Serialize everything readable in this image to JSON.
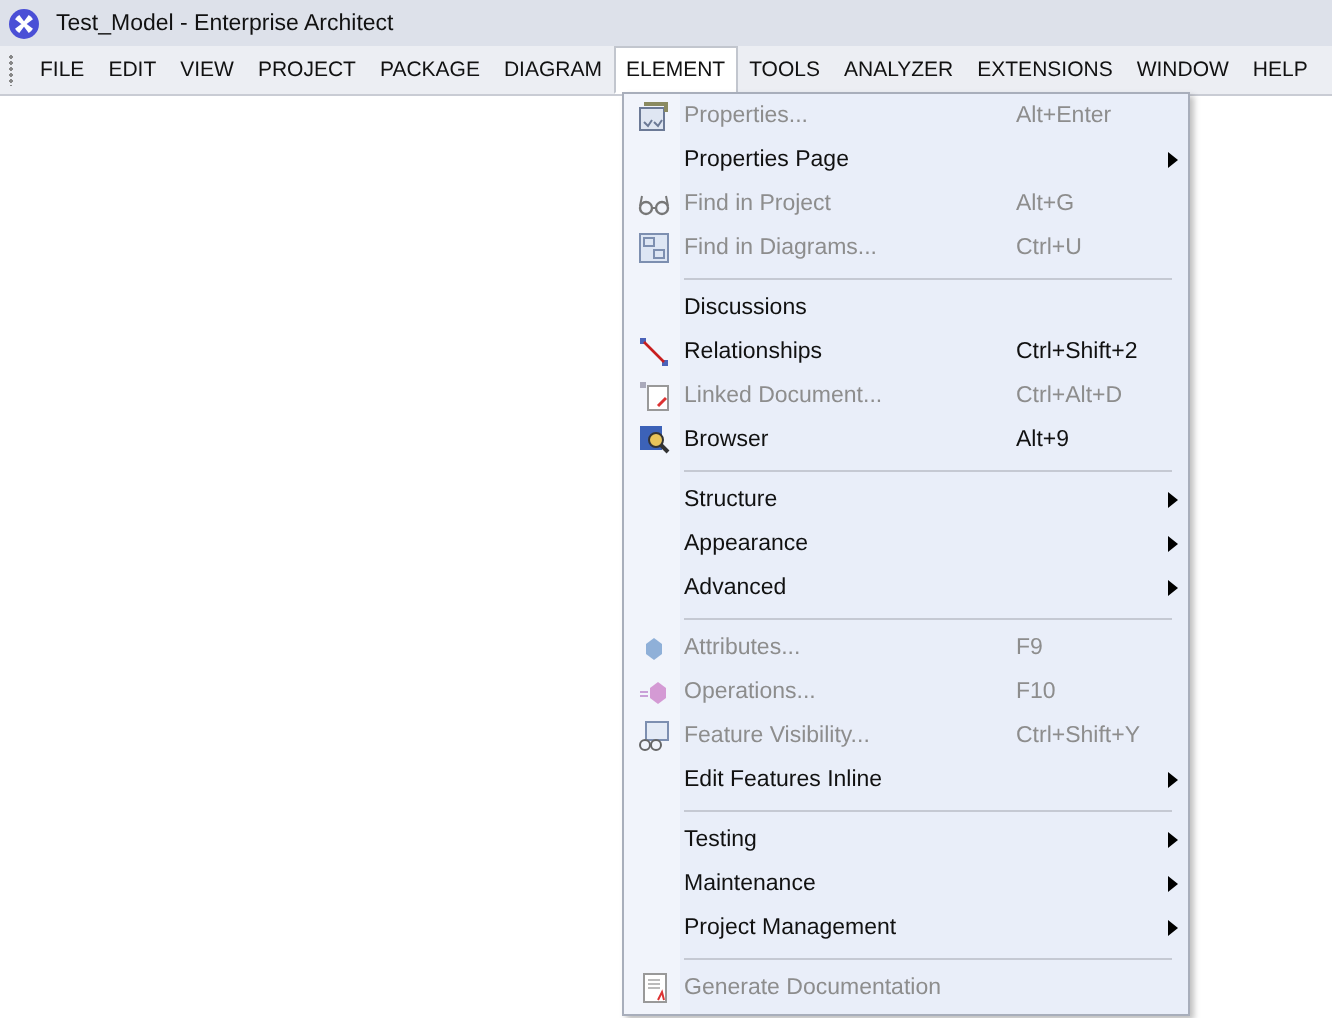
{
  "window": {
    "title": "Test_Model - Enterprise Architect"
  },
  "menubar": [
    {
      "label": "FILE",
      "selected": false
    },
    {
      "label": "EDIT",
      "selected": false
    },
    {
      "label": "VIEW",
      "selected": false
    },
    {
      "label": "PROJECT",
      "selected": false
    },
    {
      "label": "PACKAGE",
      "selected": false
    },
    {
      "label": "DIAGRAM",
      "selected": false
    },
    {
      "label": "ELEMENT",
      "selected": true
    },
    {
      "label": "TOOLS",
      "selected": false
    },
    {
      "label": "ANALYZER",
      "selected": false
    },
    {
      "label": "EXTENSIONS",
      "selected": false
    },
    {
      "label": "WINDOW",
      "selected": false
    },
    {
      "label": "HELP",
      "selected": false
    }
  ],
  "menu": {
    "items": [
      {
        "kind": "item",
        "label": "Properties...",
        "shortcut": "Alt+Enter",
        "disabled": true,
        "submenu": false
      },
      {
        "kind": "item",
        "label": "Properties Page",
        "disabled": false,
        "submenu": true
      },
      {
        "kind": "item",
        "label": "Find in Project",
        "shortcut": "Alt+G",
        "disabled": true,
        "submenu": false
      },
      {
        "kind": "item",
        "label": "Find in Diagrams...",
        "shortcut": "Ctrl+U",
        "disabled": true,
        "submenu": false
      },
      {
        "kind": "separator"
      },
      {
        "kind": "item",
        "label": "Discussions",
        "disabled": false,
        "submenu": false
      },
      {
        "kind": "item",
        "label": "Relationships",
        "shortcut": "Ctrl+Shift+2",
        "disabled": false,
        "submenu": false
      },
      {
        "kind": "item",
        "label": "Linked Document...",
        "shortcut": "Ctrl+Alt+D",
        "disabled": true,
        "submenu": false
      },
      {
        "kind": "item",
        "label": "Browser",
        "shortcut": "Alt+9",
        "disabled": false,
        "submenu": false
      },
      {
        "kind": "separator"
      },
      {
        "kind": "item",
        "label": "Structure",
        "disabled": false,
        "submenu": true
      },
      {
        "kind": "item",
        "label": "Appearance",
        "disabled": false,
        "submenu": true
      },
      {
        "kind": "item",
        "label": "Advanced",
        "disabled": false,
        "submenu": true
      },
      {
        "kind": "separator"
      },
      {
        "kind": "item",
        "label": "Attributes...",
        "shortcut": "F9",
        "disabled": true,
        "submenu": false
      },
      {
        "kind": "item",
        "label": "Operations...",
        "shortcut": "F10",
        "disabled": true,
        "submenu": false
      },
      {
        "kind": "item",
        "label": "Feature Visibility...",
        "shortcut": "Ctrl+Shift+Y",
        "disabled": true,
        "submenu": false
      },
      {
        "kind": "item",
        "label": "Edit Features Inline",
        "disabled": false,
        "submenu": true
      },
      {
        "kind": "separator"
      },
      {
        "kind": "item",
        "label": "Testing",
        "disabled": false,
        "submenu": true
      },
      {
        "kind": "item",
        "label": "Maintenance",
        "disabled": false,
        "submenu": true
      },
      {
        "kind": "item",
        "label": "Project Management",
        "disabled": false,
        "submenu": true
      },
      {
        "kind": "separator"
      },
      {
        "kind": "item",
        "label": "Generate Documentation",
        "disabled": true,
        "submenu": false
      }
    ]
  }
}
